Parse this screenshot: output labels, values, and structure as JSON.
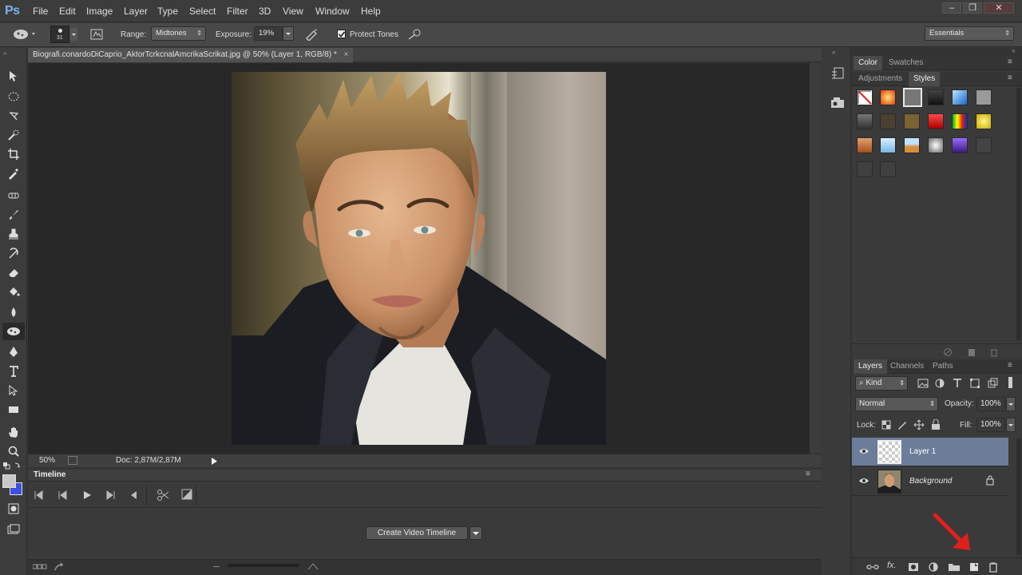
{
  "app": {
    "logo": "Ps"
  },
  "menu": [
    "File",
    "Edit",
    "Image",
    "Layer",
    "Type",
    "Select",
    "Filter",
    "3D",
    "View",
    "Window",
    "Help"
  ],
  "window_controls": {
    "minimize": "–",
    "restore": "❐",
    "close": "✕"
  },
  "options": {
    "brush_size": "31",
    "range_label": "Range:",
    "range_value": "Midtones",
    "exposure_label": "Exposure:",
    "exposure_value": "19%",
    "protect_tones_label": "Protect Tones",
    "protect_tones_checked": true,
    "workspace": "Essentials"
  },
  "document": {
    "tab_title": "Biografi.conardoDiCaprio_AktorTcrkcnalAmcrikaScrikat.jpg @ 50% (Layer 1, RGB/8) *",
    "zoom": "50%",
    "doc_size": "Doc: 2,87M/2,87M"
  },
  "timeline": {
    "title": "Timeline",
    "create_button": "Create Video Timeline"
  },
  "color_panel": {
    "tabs": [
      "Color",
      "Swatches"
    ]
  },
  "styles_panel": {
    "tabs": [
      "Adjustments",
      "Styles"
    ],
    "active_tab": "Styles"
  },
  "layers_panel": {
    "tabs": [
      "Layers",
      "Channels",
      "Paths"
    ],
    "kind_filter": "Kind",
    "blend_mode": "Normal",
    "opacity_label": "Opacity:",
    "opacity_value": "100%",
    "lock_label": "Lock:",
    "fill_label": "Fill:",
    "fill_value": "100%",
    "layers": [
      {
        "name": "Layer 1",
        "selected": true,
        "visible": true
      },
      {
        "name": "Background",
        "selected": false,
        "visible": true,
        "locked": true
      }
    ]
  },
  "colors": {
    "selected_layer": "#6b7d99",
    "annotation_arrow": "#e0201c",
    "foreground": "#c8c8c8",
    "background": "#3f4fe0"
  }
}
